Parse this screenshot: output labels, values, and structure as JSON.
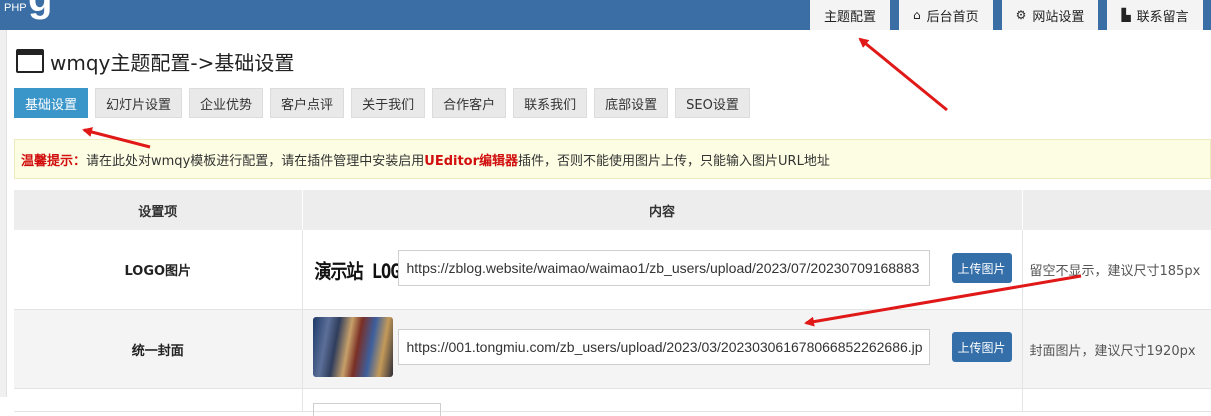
{
  "app": {
    "logo_small": "PHP",
    "logo_large": "g"
  },
  "topnav": [
    {
      "label": "主题配置",
      "icon": ""
    },
    {
      "label": "后台首页",
      "icon": "home-icon",
      "glyph": "⌂"
    },
    {
      "label": "网站设置",
      "icon": "gear-icon",
      "glyph": "⚙"
    },
    {
      "label": "联系留言",
      "icon": "grid-icon",
      "glyph": "▙"
    }
  ],
  "page": {
    "title": "wmqy主题配置->基础设置"
  },
  "tabs": [
    {
      "label": "基础设置",
      "active": true
    },
    {
      "label": "幻灯片设置"
    },
    {
      "label": "企业优势"
    },
    {
      "label": "客户点评"
    },
    {
      "label": "关于我们"
    },
    {
      "label": "合作客户"
    },
    {
      "label": "联系我们"
    },
    {
      "label": "底部设置"
    },
    {
      "label": "SEO设置"
    }
  ],
  "notice": {
    "label": "温馨提示：",
    "text_before": "请在此处对wmqy模板进行配置，请在插件管理中安装启用",
    "highlight": "UEditor编辑器",
    "text_after": "插件，否则不能使用图片上传，只能输入图片URL地址"
  },
  "table": {
    "headers": [
      "设置项",
      "内容",
      ""
    ],
    "rows": [
      {
        "label": "LOGO图片",
        "preview_text": "演示站 LOGO",
        "url": "https://zblog.website/waimao/waimao1/zb_users/upload/2023/07/20230709168883",
        "button": "上传图片",
        "hint": "留空不显示，建议尺寸185px"
      },
      {
        "label": "统一封面",
        "url": "https://001.tongmiu.com/zb_users/upload/2023/03/2023030616780668522626​86.jp",
        "button": "上传图片",
        "hint": "封面图片，建议尺寸1920px"
      }
    ]
  },
  "colors": {
    "topbar": "#3a6ea5",
    "active_tab": "#3a95c9",
    "button": "#356fa9",
    "highlight": "#d20f0f",
    "arrow": "#e01818"
  }
}
